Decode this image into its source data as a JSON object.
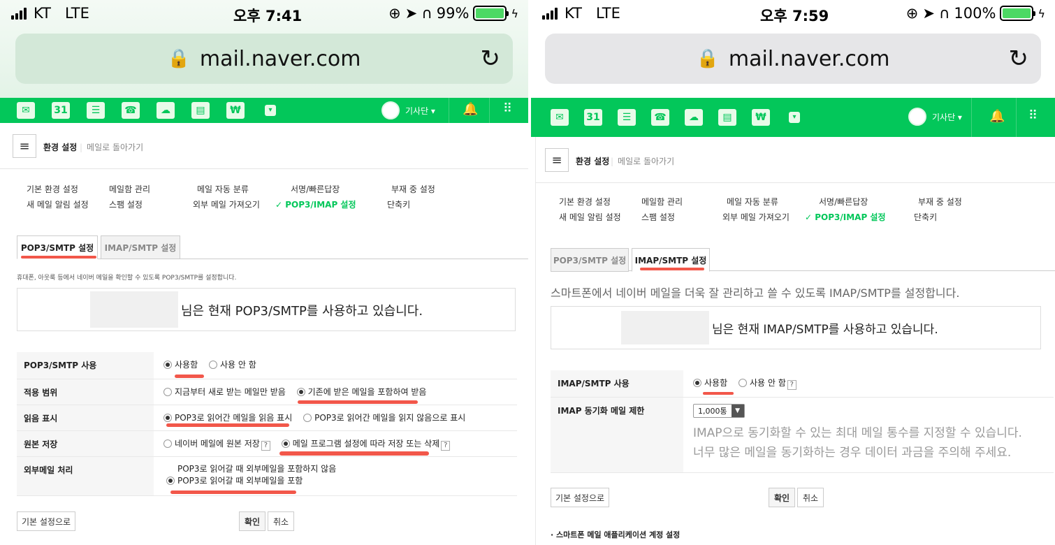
{
  "left": {
    "status": {
      "carrier": "KT",
      "network": "LTE",
      "time": "오후 7:41",
      "battery": "99%",
      "battery_level": 0.99
    },
    "browser": {
      "url": "mail.naver.com"
    },
    "topbar": {
      "user_name": "기사단 ▾",
      "calendar_day": "31",
      "icons": [
        "mail-icon",
        "calendar-icon",
        "contacts-icon",
        "phone-icon",
        "cloud-icon",
        "office-icon",
        "pay-icon",
        "more-icon"
      ]
    },
    "header": {
      "title": "환경 설정",
      "back": "메일로 돌아가기"
    },
    "menu": {
      "row1": [
        "기본 환경 설정",
        "메일함 관리",
        "메일 자동 분류",
        "서명/빠른답장",
        "부재 중 설정"
      ],
      "row2": [
        "새 메일 알림 설정",
        "스팸 설정",
        "외부 메일 가져오기",
        "✓ POP3/IMAP 설정",
        "단축키"
      ]
    },
    "tabs": [
      "POP3/SMTP 설정",
      "IMAP/SMTP 설정"
    ],
    "description": "휴대폰, 아웃룩 등에서 네이버 메일을 확인할 수 있도록 POP3/SMTP를 설정합니다.",
    "status_box": "님은 현재 POP3/SMTP를 사용하고 있습니다.",
    "settings": [
      {
        "label": "POP3/SMTP 사용",
        "options": [
          "사용함",
          "사용 안 함"
        ]
      },
      {
        "label": "적용 범위",
        "options": [
          "지금부터 새로 받는 메일만 받음",
          "기존에 받은 메일을 포함하여 받음"
        ]
      },
      {
        "label": "읽음 표시",
        "options": [
          "POP3로 읽어간 메일을 읽음 표시",
          "POP3로 읽어간 메일을 읽지 않음으로 표시"
        ]
      },
      {
        "label": "원본 저장",
        "options": [
          "네이버 메일에 원본 저장",
          "메일 프로그램 설정에 따라 저장 또는 삭제"
        ]
      },
      {
        "label": "외부메일 처리",
        "options": [
          "POP3로 읽어갈 때 외부메일을 포함하지 않음",
          "POP3로 읽어갈 때 외부메일을 포함"
        ]
      }
    ],
    "buttons": {
      "reset": "기본 설정으로",
      "confirm": "확인",
      "cancel": "취소"
    }
  },
  "right": {
    "status": {
      "carrier": "KT",
      "network": "LTE",
      "time": "오후 7:59",
      "battery": "100%",
      "battery_level": 1.0
    },
    "browser": {
      "url": "mail.naver.com"
    },
    "topbar": {
      "user_name": "기사단 ▾",
      "calendar_day": "31"
    },
    "header": {
      "title": "환경 설정",
      "back": "메일로 돌아가기"
    },
    "menu": {
      "row1": [
        "기본 환경 설정",
        "메일함 관리",
        "메일 자동 분류",
        "서명/빠른답장",
        "부재 중 설정"
      ],
      "row2": [
        "새 메일 알림 설정",
        "스팸 설정",
        "외부 메일 가져오기",
        "✓ POP3/IMAP 설정",
        "단축키"
      ]
    },
    "tabs": [
      "POP3/SMTP 설정",
      "IMAP/SMTP 설정"
    ],
    "description": "스마트폰에서 네이버 메일을 더욱 잘 관리하고 쓸 수 있도록 IMAP/SMTP를 설정합니다.",
    "status_box": "님은 현재 IMAP/SMTP를 사용하고 있습니다.",
    "settings": [
      {
        "label": "IMAP/SMTP 사용",
        "options": [
          "사용함",
          "사용 안 함"
        ]
      },
      {
        "label": "IMAP 동기화 메일 제한",
        "select_value": "1,000통",
        "help1": "IMAP으로 동기화할 수 있는 최대 메일 통수를 지정할 수 있습니다.",
        "help2": "너무 많은 메일을 동기화하는 경우 데이터 과금을 주의해 주세요."
      }
    ],
    "buttons": {
      "reset": "기본 설정으로",
      "confirm": "확인",
      "cancel": "취소"
    },
    "footer": "스마트폰 메일 애플리케이션 계정 설정"
  },
  "colors": {
    "naver_green": "#03c75a",
    "highlight_red": "#f03a2a"
  }
}
